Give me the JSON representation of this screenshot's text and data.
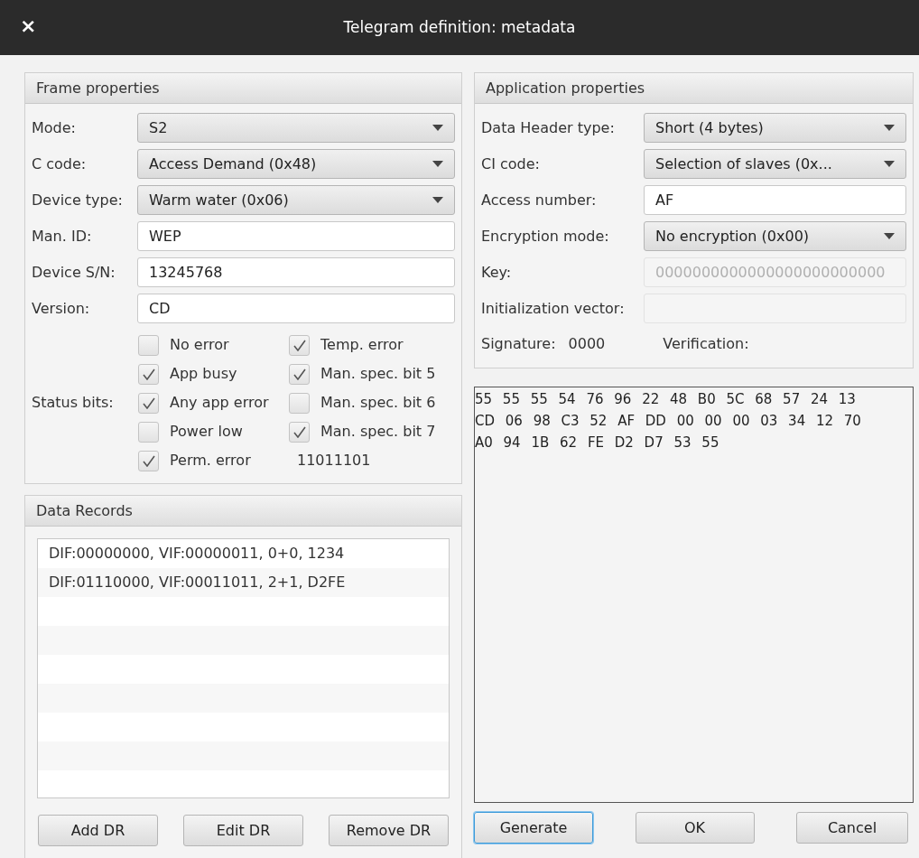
{
  "window": {
    "title": "Telegram definition: metadata",
    "close": "×"
  },
  "frame_properties": {
    "title": "Frame properties",
    "fields": [
      {
        "label": "Mode:",
        "kind": "select",
        "value": "S2"
      },
      {
        "label": "C code:",
        "kind": "select",
        "value": "Access Demand (0x48)"
      },
      {
        "label": "Device type:",
        "kind": "select",
        "value": "Warm water (0x06)"
      },
      {
        "label": "Man. ID:",
        "kind": "text",
        "value": "WEP"
      },
      {
        "label": "Device S/N:",
        "kind": "text",
        "value": "13245768"
      },
      {
        "label": "Version:",
        "kind": "text",
        "value": "CD"
      }
    ],
    "status_bits": {
      "label": "Status bits:",
      "value": "11011101",
      "checkboxes": [
        {
          "label": "No error",
          "checked": false
        },
        {
          "label": "Temp. error",
          "checked": true
        },
        {
          "label": "App busy",
          "checked": true
        },
        {
          "label": "Man. spec. bit 5",
          "checked": true
        },
        {
          "label": "Any app error",
          "checked": true
        },
        {
          "label": "Man. spec. bit 6",
          "checked": false
        },
        {
          "label": "Power low",
          "checked": false
        },
        {
          "label": "Man. spec. bit 7",
          "checked": true
        },
        {
          "label": "Perm. error",
          "checked": true
        }
      ]
    }
  },
  "data_records": {
    "title": "Data Records",
    "items": [
      "DIF:00000000, VIF:00000011, 0+0, 1234",
      "DIF:01110000, VIF:00011011, 2+1, D2FE"
    ],
    "buttons": [
      {
        "label": "Add DR"
      },
      {
        "label": "Edit DR"
      },
      {
        "label": "Remove DR"
      }
    ]
  },
  "application_properties": {
    "title": "Application properties",
    "fields": [
      {
        "label": "Data Header type:",
        "kind": "select",
        "value": "Short (4 bytes)"
      },
      {
        "label": "CI code:",
        "kind": "select",
        "value": "Selection of slaves (0x..."
      },
      {
        "label": "Access number:",
        "kind": "text",
        "value": "AF"
      },
      {
        "label": "Encryption mode:",
        "kind": "select",
        "value": "No encryption (0x00)"
      },
      {
        "label": "Key:",
        "kind": "text",
        "value": "0000000000000000000000000",
        "disabled": true
      },
      {
        "label": "Initialization vector:",
        "kind": "text",
        "disabled": true
      }
    ],
    "signature_label": "Signature:",
    "signature": "0000",
    "verification_label": "Verification:"
  },
  "hex_output": [
    "55 55 55 54 76 96 22 48 B0 5C 68 57 24 13",
    "CD 06 98 C3 52 AF DD 00 00 00 03 34 12 70",
    "A0 94 1B 62 FE D2 D7 53 55"
  ],
  "buttons": [
    {
      "label": "Generate",
      "focused": true
    },
    {
      "label": "OK",
      "focused": false
    },
    {
      "label": "Cancel",
      "focused": false
    }
  ]
}
